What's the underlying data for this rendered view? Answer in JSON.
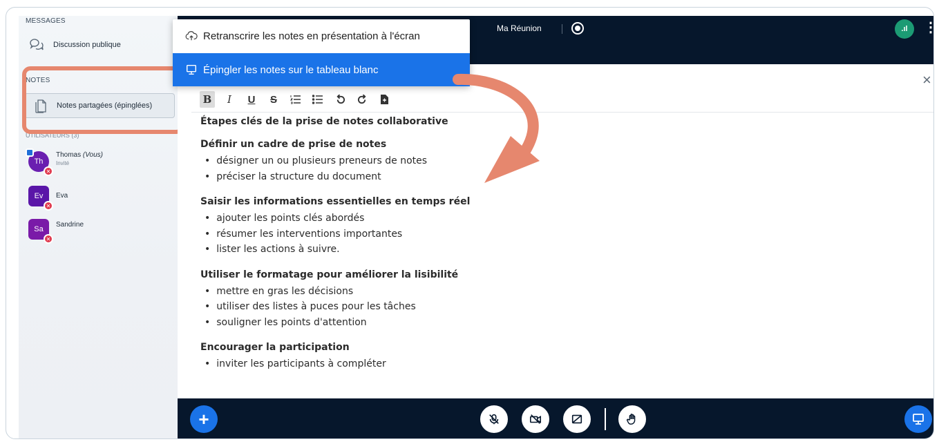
{
  "sidebar": {
    "messages_label": "MESSAGES",
    "public_chat_label": "Discussion publique",
    "notes_label": "NOTES",
    "shared_notes_label": "Notes partagées (épinglées)",
    "users_label": "UTILISATEURS (3)",
    "users": [
      {
        "initials": "Th",
        "name": "Thomas",
        "you": "(Vous)",
        "role": "Invité",
        "color": "#6a1fb0",
        "round": true
      },
      {
        "initials": "Ev",
        "name": "Eva",
        "role": "",
        "color": "#5a16a8",
        "round": false
      },
      {
        "initials": "Sa",
        "name": "Sandrine",
        "role": "",
        "color": "#7a1aa8",
        "round": false
      }
    ]
  },
  "topbar": {
    "meeting_title": "Ma Réunion",
    "connection_label": ".ıl"
  },
  "dropdown": {
    "item1_label": "Retranscrire les notes en présentation à l'écran",
    "item2_label": "Épingler les notes sur le tableau blanc"
  },
  "toolbar": {
    "bold": "B",
    "italic": "I",
    "underline": "U",
    "strike": "S"
  },
  "document": {
    "title": "Étapes clés de la prise de notes collaborative",
    "sections": [
      {
        "heading": "Définir un cadre de prise de notes",
        "items": [
          "désigner un ou plusieurs preneurs de notes",
          "préciser la structure du document"
        ]
      },
      {
        "heading": "Saisir les informations essentielles en temps réel",
        "items": [
          "ajouter les points clés abordés",
          "résumer les interventions importantes",
          "lister les actions à suivre."
        ]
      },
      {
        "heading": "Utiliser le formatage pour améliorer la lisibilité",
        "items": [
          "mettre en gras les décisions",
          "utiliser des listes à puces pour les tâches",
          "souligner les points d'attention"
        ]
      },
      {
        "heading": "Encourager la participation",
        "items": [
          "inviter les participants à compléter"
        ]
      }
    ]
  },
  "colors": {
    "accent": "#1a73e8",
    "dark_bar": "#06172c",
    "highlight": "#e6876e",
    "connection": "#1c9b74",
    "muted": "#e0394d"
  }
}
